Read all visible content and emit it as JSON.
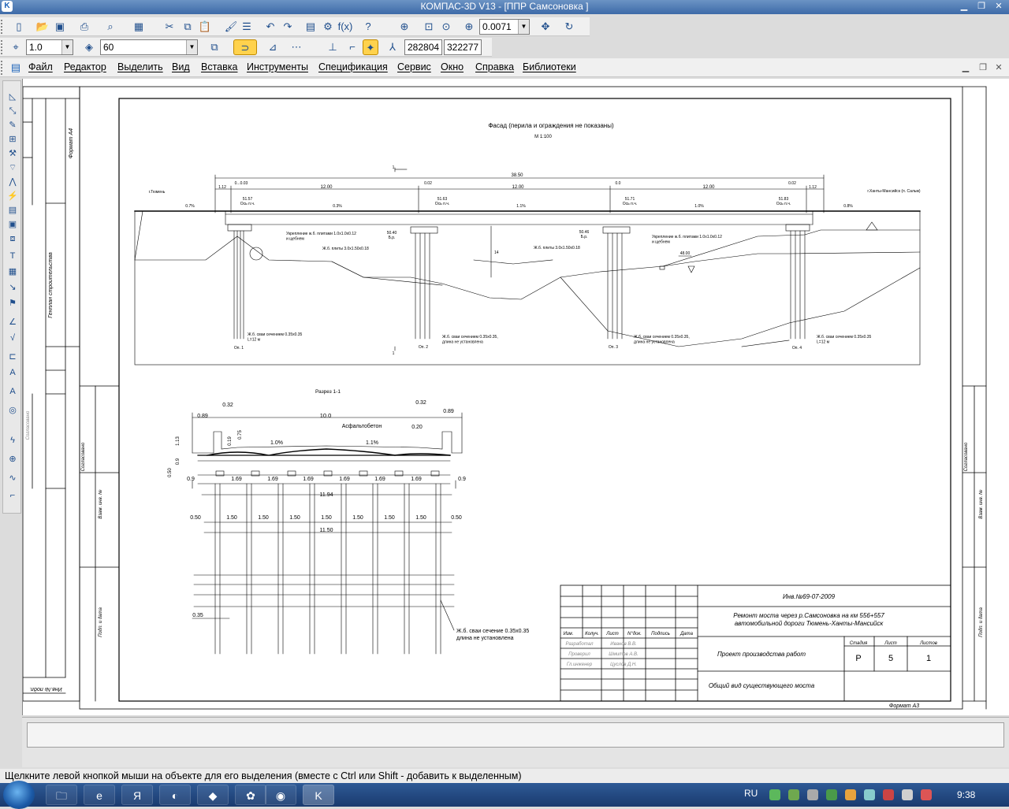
{
  "window": {
    "title": "КОМПАС-3D V13 - [ППР Самсоновка ]",
    "app_icon": "K"
  },
  "toolbar1": {
    "zoom_value": "0.0071"
  },
  "toolbar2": {
    "line_scale": "1.0",
    "layer_value": "60",
    "coord_x": "282804",
    "coord_y": "322277"
  },
  "menu": [
    "Файл",
    "Редактор",
    "Выделить",
    "Вид",
    "Вставка",
    "Инструменты",
    "Спецификация",
    "Сервис",
    "Окно",
    "Справка",
    "Библиотеки"
  ],
  "drawing": {
    "facade_title": "Фасад (перила и ограждения не показаны)",
    "facade_scale": "М 1:100",
    "total_length": "38.50",
    "span_1": "12.00",
    "span_2": "12.00",
    "span_3": "12.00",
    "end_left": "1.12",
    "end_right": "1.12",
    "level_0_03": "0...0.03",
    "level_0_02a": "0.02",
    "level_0_0": "0.0",
    "level_0_02b": "0.02",
    "label_tyumen": "г.Тюмень",
    "label_khanty": "г.Ханты-Мансийск (п. Сальм)",
    "slope_07": "0.7%",
    "slope_03": "0.3%",
    "slope_11": "1.1%",
    "slope_10": "1.0%",
    "slope_08": "0.8%",
    "elev_51_57": "51.57",
    "elev_51_63": "51.63",
    "elev_51_71": "51.71",
    "elev_51_83": "51.83",
    "os_pch": "Ось п.ч.",
    "elev_50_40": "50.40",
    "elev_50_46": "50.46",
    "br_label": "Б.р.",
    "ukreplenie_left": "Укрепление ж.б. плитами 1.0х1.0х0.12\nи щебнем",
    "ukreplenie_right": "Укрепление ж.б. плитами 1.0х1.0х0.12\nи щебнем",
    "plity_left": "Ж.б. плиты 3.0х1.50х0.18",
    "plity_right": "Ж.б. плиты 3.0х1.50х0.18",
    "dim_14": "14",
    "dim_48_00": "48.00",
    "svai_1": "Ж.б. сваи сечением 0.35х0.35\nL=12 м",
    "svai_2": "Ж.б. сваи сечением 0.35х0.35,\nдлина не установлена",
    "svai_3": "Ж.б. сваи сечением 0.35х0.35,\nдлина не установлена",
    "svai_4": "Ж.б. сваи сечением 0.35х0.35\nL=12 м",
    "op1": "Оп. 1",
    "op2": "Оп. 2",
    "op3": "Оп. 3",
    "op4": "Оп. 4",
    "section_mark": "1",
    "section_title": "Разрез 1-1",
    "asfalt": "Асфальтобетон",
    "dim_10_0": "10.0",
    "dim_0_32a": "0.32",
    "dim_0_32b": "0.32",
    "dim_0_89a": "0.89",
    "dim_0_89b": "0.89",
    "dim_0_20": "0.20",
    "dim_1_13": "1.13",
    "dim_0_19": "0.19",
    "dim_0_75": "0.75",
    "dim_0_9": "0.9",
    "dim_0_50": "0.50",
    "slope_1_0": "1.0%",
    "slope_1_1": "1.1%",
    "beam_spacing": [
      "0.9",
      "1.69",
      "1.69",
      "1.69",
      "1.69",
      "1.69",
      "1.69",
      "0.9"
    ],
    "dim_11_94": "11.94",
    "pile_spacing": [
      "0.50",
      "1.50",
      "1.50",
      "1.50",
      "1.50",
      "1.50",
      "1.50",
      "1.50",
      "0.50"
    ],
    "dim_11_50": "11.50",
    "dim_0_35": "0.35",
    "svai_section": "Ж.б. сваи сечение 0.35х0.35\nдлина не установлена",
    "left_stamp_format": "Формат А4",
    "left_stamp_gen": "Генплан строительства",
    "left_stamp_inv": "Инв.№ подл.",
    "left_stamp_podpis": "Подп. и дата",
    "left_stamp_vzam": "Взам. инв. №",
    "left_stamp_sogl": "Согласовано",
    "tb_doc_num": "Инв.№69-07-2009",
    "tb_object": "Ремонт моста через р.Самсоновка на км 556+557\nавтомобильной дороги Тюмень-Ханты-Мансийск",
    "tb_project": "Проект производства работ",
    "tb_sheet_title": "Общий вид существующего моста",
    "tb_col_izm": "Изм.",
    "tb_col_kol": "Колуч.",
    "tb_col_list": "Лист",
    "tb_col_ndok": "N°док.",
    "tb_col_podp": "Подпись",
    "tb_col_data": "Дата",
    "tb_razrab": "Разработал",
    "tb_razrab_name": "Иванов В.В.",
    "tb_proveril": "Проверил",
    "tb_proveril_name": "Шмитов А.В.",
    "tb_gip": "Гл.инженер",
    "tb_gip_name": "Цуслов Д.Н.",
    "tb_stadia_h": "Стадия",
    "tb_list_h": "Лист",
    "tb_listov_h": "Листов",
    "tb_stadia": "Р",
    "tb_list": "5",
    "tb_listov": "1",
    "format": "Формат А3"
  },
  "status": {
    "hint": "Щелкните левой кнопкой мыши на объекте для его выделения (вместе с Ctrl или Shift - добавить к выделенным)"
  },
  "taskbar": {
    "lang": "RU",
    "time": "9:38"
  }
}
